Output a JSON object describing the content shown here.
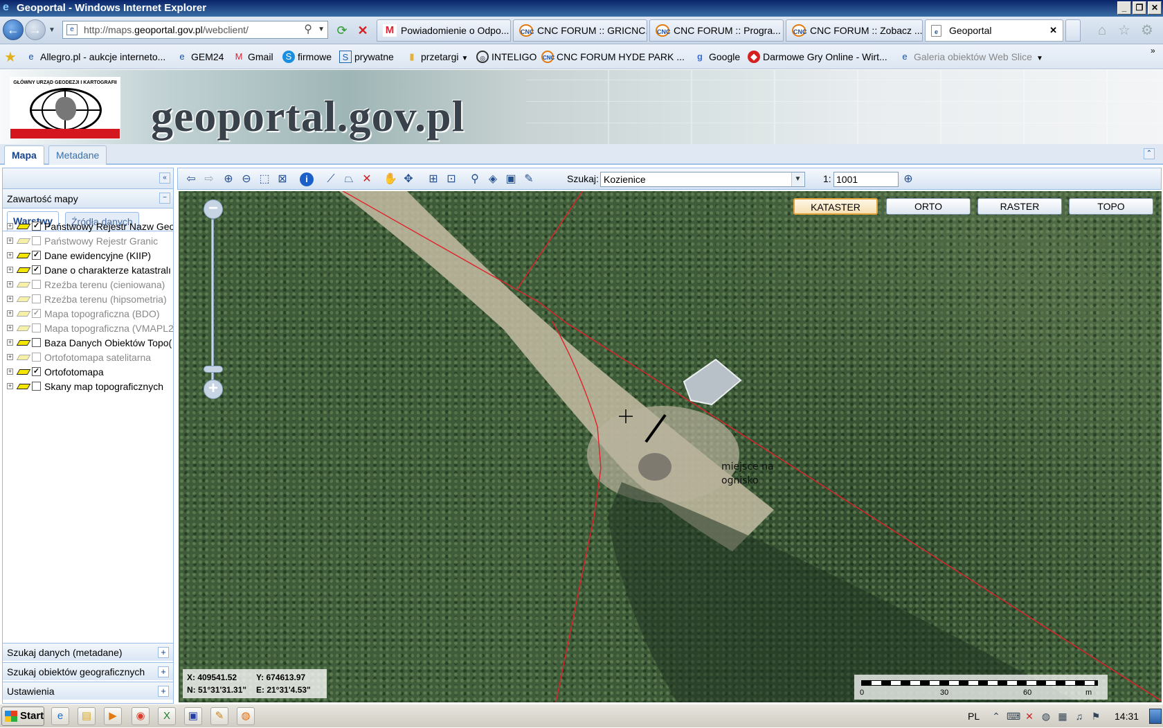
{
  "window": {
    "title": "Geoportal - Windows Internet Explorer",
    "buttons": {
      "minimize": "_",
      "maximize": "❐",
      "close": "✕"
    }
  },
  "browser": {
    "address_url_prefix": "http://maps.",
    "address_url_domain": "geoportal.gov.pl",
    "address_url_path": "/webclient/",
    "tabs": [
      {
        "label": "Powiadomienie o Odpo...",
        "icon": "gmail-icon"
      },
      {
        "label": "CNC FORUM :: GRICNC...",
        "icon": "cnc-forum-icon"
      },
      {
        "label": "CNC FORUM :: Progra...",
        "icon": "cnc-forum-icon"
      },
      {
        "label": "CNC FORUM :: Zobacz ...",
        "icon": "cnc-forum-icon"
      },
      {
        "label": "Geoportal",
        "icon": "page-icon"
      }
    ],
    "tab_close": "✕"
  },
  "favorites": [
    {
      "label": "Allegro.pl - aukcje interneto..."
    },
    {
      "label": "GEM24"
    },
    {
      "label": "Gmail"
    },
    {
      "label": "firmowe"
    },
    {
      "label": "prywatne"
    },
    {
      "label": "przetargi"
    },
    {
      "label": "INTELIGO"
    },
    {
      "label": "CNC FORUM  HYDE PARK ..."
    },
    {
      "label": "Google"
    },
    {
      "label": "Darmowe Gry Online - Wirt..."
    },
    {
      "label": "Galeria obiektów Web Slice"
    }
  ],
  "geoportal": {
    "logo_text": "GŁÓWNY URZĄD GEODEZJI I KARTOGRAFII",
    "site_title": "geoportal.gov.pl",
    "main_tabs": [
      {
        "label": "Mapa"
      },
      {
        "label": "Metadane"
      }
    ]
  },
  "left_panel": {
    "content_title": "Zawartość mapy",
    "subtabs": [
      {
        "label": "Warstwy"
      },
      {
        "label": "Źródła danych"
      }
    ],
    "layers": [
      {
        "label": "Państwowy Rejestr Nazw Geo",
        "checked": "✓",
        "dim": false
      },
      {
        "label": "Państwowy Rejestr Granic",
        "checked": "",
        "dim": true
      },
      {
        "label": "Dane ewidencyjne (KIIP)",
        "checked": "✓",
        "dim": false
      },
      {
        "label": "Dane o charakterze katastralı",
        "checked": "✓",
        "dim": false
      },
      {
        "label": "Rzeźba terenu (cieniowana)",
        "checked": "",
        "dim": true
      },
      {
        "label": "Rzeźba terenu (hipsometria)",
        "checked": "",
        "dim": true
      },
      {
        "label": "Mapa topograficzna (BDO)",
        "checked": "✓",
        "dim": true
      },
      {
        "label": "Mapa topograficzna (VMAPL2",
        "checked": "",
        "dim": true
      },
      {
        "label": "Baza Danych Obiektów Topo(",
        "checked": "",
        "dim": false
      },
      {
        "label": "Ortofotomapa satelitarna",
        "checked": "",
        "dim": true
      },
      {
        "label": "Ortofotomapa",
        "checked": "✓",
        "dim": false
      },
      {
        "label": "Skany map topograficznych",
        "checked": "",
        "dim": false
      }
    ],
    "footer_sections": [
      {
        "label": "Szukaj danych (metadane)"
      },
      {
        "label": "Szukaj obiektów geograficznych"
      },
      {
        "label": "Ustawienia"
      }
    ]
  },
  "toolbar": {
    "search_label": "Szukaj:",
    "search_value": "Kozienice",
    "scale_label": "1:",
    "scale_value": "1001"
  },
  "map": {
    "layer_buttons": [
      {
        "label": "KATASTER",
        "active": true
      },
      {
        "label": "ORTO",
        "active": false
      },
      {
        "label": "RASTER",
        "active": false
      },
      {
        "label": "TOPO",
        "active": false
      }
    ],
    "coords": {
      "x": "X: 409541.52",
      "y": "Y: 674613.97",
      "n": "N: 51°31'31.31\"",
      "e": "E: 21°31'4.53\""
    },
    "scale_ticks": [
      "0",
      "30",
      "60",
      "m"
    ],
    "annotation_line1": "miejsce na",
    "annotation_line2": "ognisko",
    "parcel_line_color": "#e0202a"
  },
  "taskbar": {
    "start_label": "Start",
    "language": "PL",
    "clock": "14:31"
  }
}
